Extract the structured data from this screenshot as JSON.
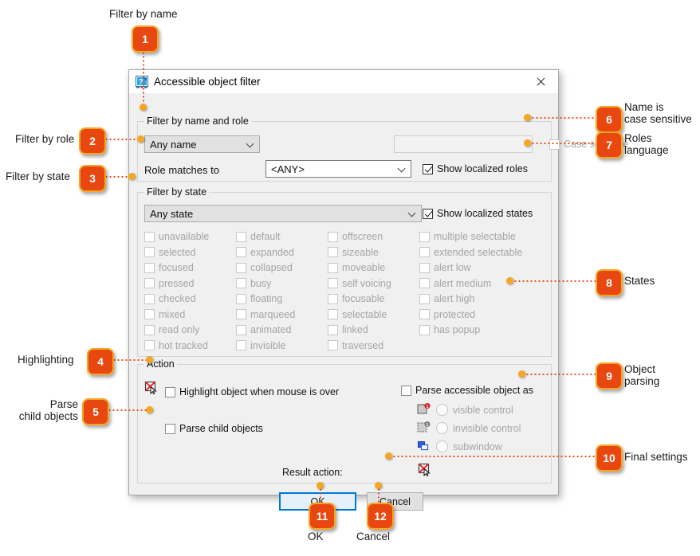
{
  "dialog": {
    "title": "Accessible object filter",
    "icon": "accessibility-filter-icon",
    "close_label": "Close",
    "groups": {
      "name_and_role": {
        "title": "Filter by name and role",
        "name_combo_value": "Any name",
        "name_text_value": "",
        "name_text_placeholder": "",
        "role_label": "Role matches to",
        "role_combo_value": "<ANY>",
        "case_sensitive_label": "Case sensitive",
        "case_sensitive_checked": false,
        "case_sensitive_enabled": false,
        "show_localized_roles_label": "Show localized roles",
        "show_localized_roles_checked": true
      },
      "state": {
        "title": "Filter by state",
        "state_combo_value": "Any state",
        "show_localized_states_label": "Show localized states",
        "show_localized_states_checked": true,
        "columns": [
          [
            "unavailable",
            "selected",
            "focused",
            "pressed",
            "checked",
            "mixed",
            "read only",
            "hot tracked"
          ],
          [
            "default",
            "expanded",
            "collapsed",
            "busy",
            "floating",
            "marqueed",
            "animated",
            "invisible"
          ],
          [
            "offscreen",
            "sizeable",
            "moveable",
            "self voicing",
            "focusable",
            "selectable",
            "linked",
            "traversed"
          ],
          [
            "multiple selectable",
            "extended selectable",
            "alert low",
            "alert medium",
            "alert high",
            "protected",
            "has popup"
          ]
        ]
      },
      "action": {
        "title": "Action",
        "highlight_label": "Highlight object when mouse is over",
        "highlight_checked": false,
        "highlight_icon": "no-highlight-cursor-icon",
        "parse_child_label": "Parse child objects",
        "parse_child_checked": false,
        "parse_as_label": "Parse accessible object as",
        "parse_as_checked": false,
        "parse_options": [
          {
            "label": "visible control",
            "icon": "visible-control-icon",
            "selected": false
          },
          {
            "label": "invisible control",
            "icon": "invisible-control-icon",
            "selected": false
          },
          {
            "label": "subwindow",
            "icon": "subwindow-icon",
            "selected": false
          }
        ],
        "result_action_label": "Result action:",
        "result_action_icon": "no-highlight-cursor-icon"
      }
    },
    "buttons": {
      "ok": "OK",
      "cancel": "Cancel"
    }
  },
  "callouts": [
    {
      "n": "1",
      "label": "Filter by name"
    },
    {
      "n": "2",
      "label": "Filter by role"
    },
    {
      "n": "3",
      "label": "Filter by state"
    },
    {
      "n": "4",
      "label": "Highlighting"
    },
    {
      "n": "5",
      "label": "Parse\nchild objects"
    },
    {
      "n": "6",
      "label": "Name is\ncase sensitive"
    },
    {
      "n": "7",
      "label": "Roles\nlanguage"
    },
    {
      "n": "8",
      "label": "States"
    },
    {
      "n": "9",
      "label": "Object\nparsing"
    },
    {
      "n": "10",
      "label": "Final settings"
    },
    {
      "n": "11",
      "label": "OK"
    },
    {
      "n": "12",
      "label": "Cancel"
    }
  ],
  "colors": {
    "callout_fill": "#e8470f",
    "callout_border": "#f5a623",
    "dot": "#f5a623",
    "accent_blue": "#0078d7",
    "dialog_bg": "#f0f0f0"
  }
}
